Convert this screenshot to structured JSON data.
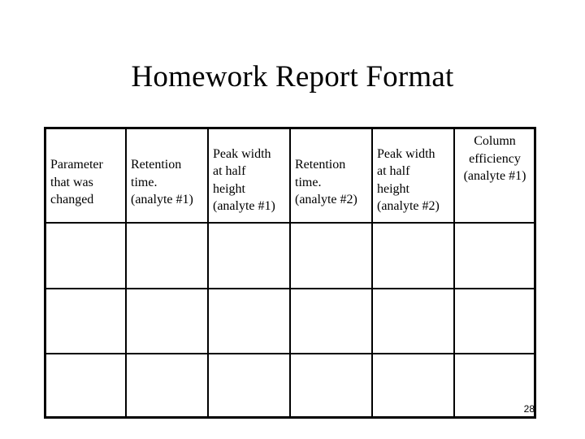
{
  "slide": {
    "title": "Homework Report Format",
    "page_number": "28"
  },
  "table": {
    "headers": [
      "Parameter\nthat was\nchanged",
      "Retention\ntime.\n(analyte #1)",
      "Peak width\nat half\nheight\n(analyte #1)",
      "Retention\ntime.\n(analyte #2)",
      "Peak width\nat half\nheight\n(analyte #2)",
      "Column\nefficiency\n(analyte #1)"
    ],
    "rows": [
      [
        "",
        "",
        "",
        "",
        "",
        ""
      ],
      [
        "",
        "",
        "",
        "",
        "",
        ""
      ],
      [
        "",
        "",
        "",
        "",
        "",
        ""
      ]
    ]
  }
}
